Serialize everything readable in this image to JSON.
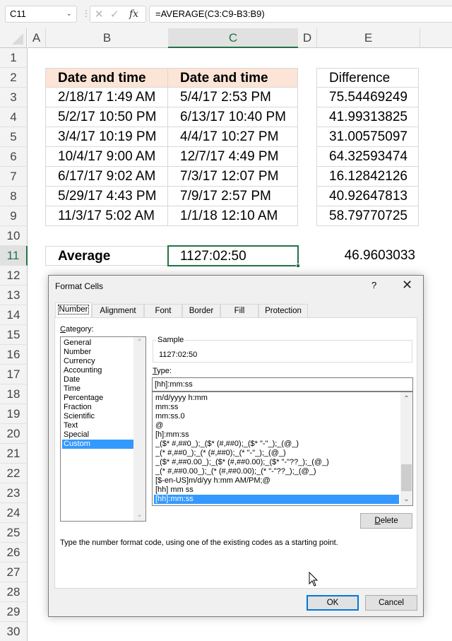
{
  "formula_bar": {
    "name_box": "C11",
    "cancel_icon": "✕",
    "enter_icon": "✓",
    "fx_label": "fx",
    "formula": "=AVERAGE(C3:C9-B3:B9)"
  },
  "columns": [
    "A",
    "B",
    "C",
    "D",
    "E"
  ],
  "selected_column": "C",
  "rows": [
    "1",
    "2",
    "3",
    "4",
    "5",
    "6",
    "7",
    "8",
    "9",
    "10",
    "11",
    "12",
    "13",
    "14",
    "15",
    "16",
    "17",
    "18",
    "19",
    "20",
    "21",
    "22",
    "23",
    "24",
    "25",
    "26",
    "27",
    "28",
    "29",
    "30"
  ],
  "selected_row": "11",
  "table": {
    "headers": [
      "Date and time",
      "Date and time",
      "Difference"
    ],
    "rows": [
      {
        "start": "2/18/17 1:49 AM",
        "end": "5/4/17 2:53 PM",
        "diff": "75.54469249"
      },
      {
        "start": "5/2/17 10:50 PM",
        "end": "6/13/17 10:40 PM",
        "diff": "41.99313825"
      },
      {
        "start": "3/4/17 10:19 PM",
        "end": "4/4/17 10:27 PM",
        "diff": "31.00575097"
      },
      {
        "start": "10/4/17 9:00 AM",
        "end": "12/7/17 4:49 PM",
        "diff": "64.32593474"
      },
      {
        "start": "6/17/17 9:02 AM",
        "end": "7/3/17 12:07 PM",
        "diff": "16.12842126"
      },
      {
        "start": "5/29/17 4:43 PM",
        "end": "7/9/17 2:57 PM",
        "diff": "40.92647813"
      },
      {
        "start": "11/3/17 5:02 AM",
        "end": "1/1/18 12:10 AM",
        "diff": "58.79770725"
      }
    ],
    "average_label": "Average",
    "average_value": "1127:02:50",
    "average_diff": "46.9603033"
  },
  "dialog": {
    "title": "Format Cells",
    "help": "?",
    "close": "✕",
    "tabs": [
      "Number",
      "Alignment",
      "Font",
      "Border",
      "Fill",
      "Protection"
    ],
    "active_tab": "Number",
    "category_label_first": "C",
    "category_label_rest": "ategory:",
    "categories": [
      "General",
      "Number",
      "Currency",
      "Accounting",
      "Date",
      "Time",
      "Percentage",
      "Fraction",
      "Scientific",
      "Text",
      "Special",
      "Custom"
    ],
    "selected_category": "Custom",
    "sample_label": "Sample",
    "sample_value": "1127:02:50",
    "type_label_first": "T",
    "type_label_rest": "ype:",
    "type_value": "[hh]:mm:ss",
    "type_list": [
      "m/d/yyyy h:mm",
      "mm:ss",
      "mm:ss.0",
      "@",
      "[h]:mm:ss",
      "_($* #,##0_);_($* (#,##0);_($* \"-\"_);_(@_)",
      "_(* #,##0_);_(* (#,##0);_(* \"-\"_);_(@_)",
      "_($* #,##0.00_);_($* (#,##0.00);_($* \"-\"??_);_(@_)",
      "_(* #,##0.00_);_(* (#,##0.00);_(* \"-\"??_);_(@_)",
      "[$-en-US]m/d/yy h:mm AM/PM;@",
      "[hh] mm ss",
      "[hh]:mm:ss"
    ],
    "selected_type": "[hh]:mm:ss",
    "delete_first": "D",
    "delete_rest": "elete",
    "hint": "Type the number format code, using one of the existing codes as a starting point.",
    "ok_label": "OK",
    "cancel_label": "Cancel"
  },
  "colors": {
    "excel_green": "#217346",
    "header_fill": "#fce4d6",
    "selection_blue": "#3399ff",
    "default_button_border": "#0078d7"
  }
}
